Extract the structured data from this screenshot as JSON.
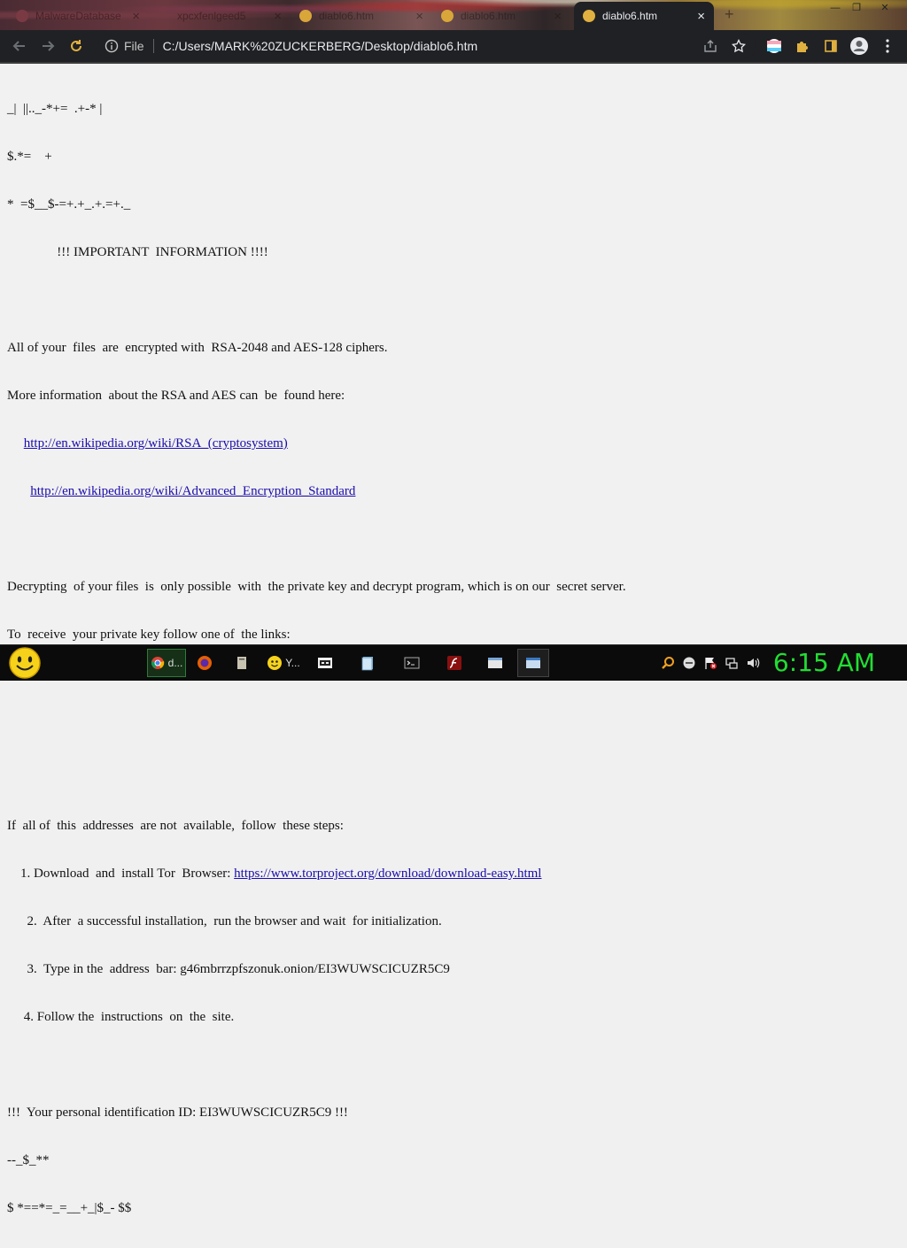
{
  "tabs": [
    {
      "title": "MalwareDatabase",
      "active": false
    },
    {
      "title": "xpcxfenlgeed5",
      "active": false
    },
    {
      "title": "diablo6.htm",
      "active": false
    },
    {
      "title": "diablo6.htm",
      "active": false
    },
    {
      "title": "diablo6.htm",
      "active": true
    }
  ],
  "new_tab_label": "+",
  "close_symbol": "×",
  "address_bar": {
    "scheme_label": "File",
    "url": "C:/Users/MARK%20ZUCKERBERG/Desktop/diablo6.htm"
  },
  "document": {
    "junk_lines": [
      "_|  ||.._-*+=  .+-* |",
      "$.*=    +",
      "*  =$__$-=+.+_.+.=+._"
    ],
    "heading": "               !!! IMPORTANT  INFORMATION !!!!",
    "para1_line1": "All of your  files  are  encrypted with  RSA-2048 and AES-128 ciphers.",
    "para1_line2": "More information  about the RSA and AES can  be  found here:",
    "link_rsa": "http://en.wikipedia.org/wiki/RSA_(cryptosystem)",
    "link_aes": "http://en.wikipedia.org/wiki/Advanced_Encryption_Standard",
    "para2_line1": "Decrypting  of your files  is  only possible  with  the private key and decrypt program, which is on our  secret server.",
    "para2_line2": "To  receive  your private key follow one of  the links:",
    "steps_intro": "If  all of  this  addresses  are not  available,  follow  these steps:",
    "step1_prefix": "    1. Download  and  install Tor  Browser: ",
    "step1_link": "https://www.torproject.org/download/download-easy.html",
    "step2": "      2.  After  a successful installation,  run the browser and wait  for initialization.",
    "step3": "      3.  Type in the  address  bar: g46mbrrzpfszonuk.onion/EI3WUWSCICUZR5C9",
    "step4": "     4. Follow the  instructions  on  the  site.",
    "id_line": "!!!  Your personal identification ID: EI3WUWSCICUZR5C9 !!!",
    "tail_lines": [
      "--_$_**",
      "$ *==*=_=__+_|$_- $$"
    ]
  },
  "taskbar": {
    "items": [
      {
        "name": "chrome-task",
        "label": "d..."
      },
      {
        "name": "firefox-task",
        "label": ""
      },
      {
        "name": "explorer-task",
        "label": ""
      },
      {
        "name": "yahoo-task",
        "label": "Y..."
      },
      {
        "name": "7zip-task",
        "label": ""
      },
      {
        "name": "notepad-task",
        "label": ""
      },
      {
        "name": "cmd-task",
        "label": ""
      },
      {
        "name": "flash-task",
        "label": ""
      },
      {
        "name": "window-task-1",
        "label": ""
      },
      {
        "name": "window-task-2",
        "label": ""
      }
    ],
    "clock": "6:15 AM"
  },
  "colors": {
    "clock": "#22dd33",
    "link": "#1a0dab",
    "toolbar": "#202124"
  }
}
